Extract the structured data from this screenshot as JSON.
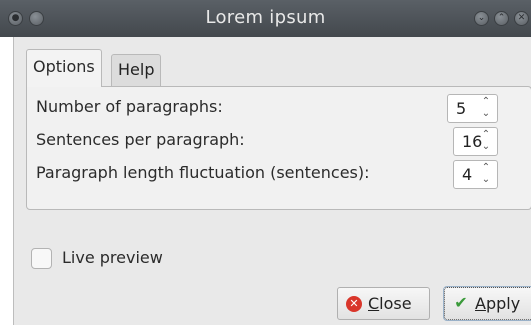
{
  "window": {
    "title": "Lorem ipsum"
  },
  "tabs": [
    {
      "label": "Options",
      "active": true
    },
    {
      "label": "Help",
      "active": false
    }
  ],
  "options": {
    "paragraphs": {
      "label": "Number of paragraphs:",
      "value": "5"
    },
    "sentences": {
      "label": "Sentences per paragraph:",
      "value": "16"
    },
    "fluctuation": {
      "label": "Paragraph length fluctuation (sentences):",
      "value": "4"
    }
  },
  "live_preview": {
    "label": "Live preview",
    "checked": false
  },
  "buttons": {
    "close": {
      "mnemonic": "C",
      "rest": "lose"
    },
    "apply": {
      "mnemonic": "A",
      "rest": "pply"
    }
  },
  "icons": {
    "window_menu": "pin-icon",
    "window_shade": "circle-icon",
    "minimize": "chevron-down-icon",
    "maximize": "chevron-up-icon",
    "close": "close-icon"
  }
}
